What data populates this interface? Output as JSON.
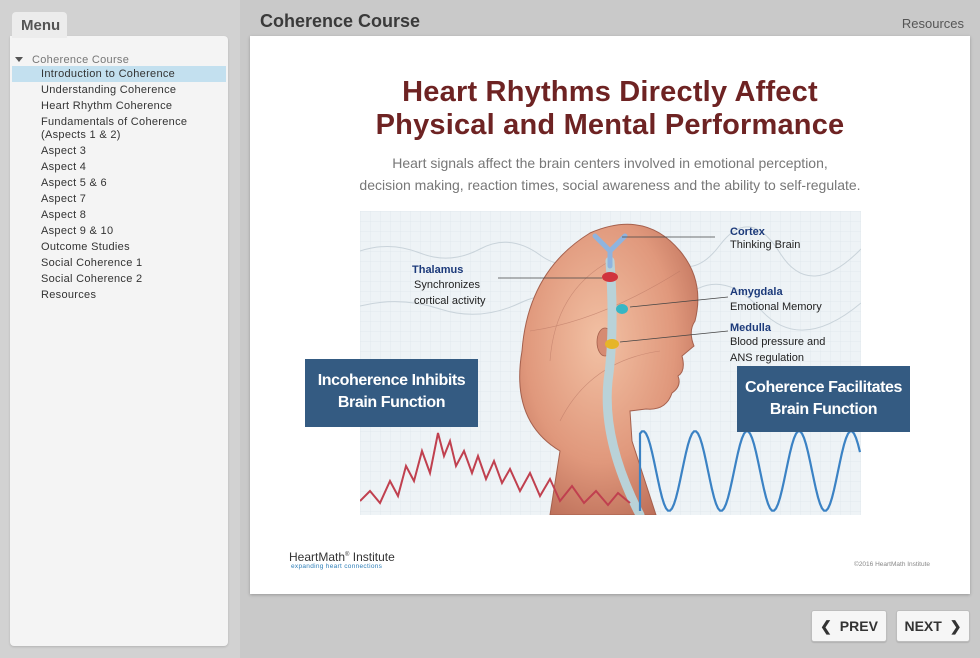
{
  "sidebar": {
    "menu_tab_label": "Menu",
    "root_label": "Coherence Course",
    "items": [
      {
        "label": "Introduction to Coherence"
      },
      {
        "label": "Understanding Coherence"
      },
      {
        "label": "Heart Rhythm Coherence"
      },
      {
        "label": "Fundamentals of Coherence\n(Aspects 1 & 2)"
      },
      {
        "label": "Aspect 3"
      },
      {
        "label": "Aspect 4"
      },
      {
        "label": "Aspect 5 & 6"
      },
      {
        "label": "Aspect 7"
      },
      {
        "label": "Aspect 8"
      },
      {
        "label": "Aspect 9 & 10"
      },
      {
        "label": "Outcome Studies"
      },
      {
        "label": "Social Coherence 1"
      },
      {
        "label": "Social Coherence 2"
      },
      {
        "label": "Resources"
      }
    ],
    "active_index": 0
  },
  "header": {
    "course_title": "Coherence Course",
    "resources_label": "Resources"
  },
  "slide": {
    "title_line1": "Heart Rhythms Directly Affect",
    "title_line2": "Physical and Mental Performance",
    "subtitle_line1": "Heart signals affect the brain centers involved in emotional perception,",
    "subtitle_line2": "decision making, reaction times, social awareness and the ability to self-regulate.",
    "figure": {
      "cortex_title": "Cortex",
      "cortex_desc": "Thinking Brain",
      "thalamus_title": "Thalamus",
      "thalamus_desc1": "Synchronizes",
      "thalamus_desc2": "cortical activity",
      "amygdala_title": "Amygdala",
      "amygdala_desc": "Emotional Memory",
      "medulla_title": "Medulla",
      "medulla_desc1": "Blood pressure and",
      "medulla_desc2": "ANS regulation"
    },
    "callout_left_line1": "Incoherence Inhibits",
    "callout_left_line2": "Brain Function",
    "callout_right_line1": "Coherence Facilitates",
    "callout_right_line2": "Brain Function",
    "logo_name": "HeartMath",
    "logo_reg": "®",
    "logo_name_suffix": " Institute",
    "logo_tagline": "expanding heart connections",
    "copyright": "©2016 HeartMath Institute"
  },
  "nav": {
    "prev_label": "PREV",
    "next_label": "NEXT"
  },
  "colors": {
    "title": "#6e2323",
    "callout": "#345b82",
    "active_menu": "#c3e0ef",
    "incoherent_wave": "#c0404f",
    "coherent_wave": "#3b82c4"
  },
  "icons": {
    "tree_caret": "caret-down-icon",
    "prev": "chevron-left-icon",
    "next": "chevron-right-icon"
  }
}
